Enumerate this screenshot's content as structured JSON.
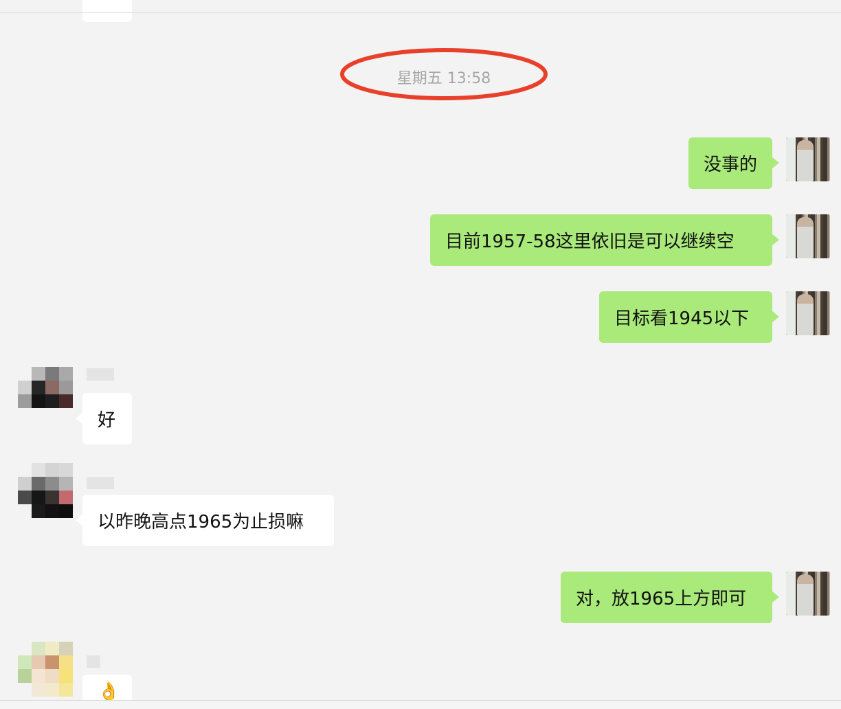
{
  "timestamp": "星期五 13:58",
  "colors": {
    "my_bubble": "#a9ea7a",
    "their_bubble": "#ffffff",
    "background": "#f3f3f3",
    "highlight_oval": "#e8402a",
    "timestamp_text": "#a6a6a6"
  },
  "messages": [
    {
      "sender": "me",
      "text": "没事的"
    },
    {
      "sender": "me",
      "text": "目前1957-58这里依旧是可以继续空"
    },
    {
      "sender": "me",
      "text": "目标看1945以下"
    },
    {
      "sender": "them",
      "text": "好"
    },
    {
      "sender": "them",
      "text": "以昨晚高点1965为止损嘛"
    },
    {
      "sender": "me",
      "text": "对，放1965上方即可"
    },
    {
      "sender": "them",
      "text": "👌"
    }
  ]
}
